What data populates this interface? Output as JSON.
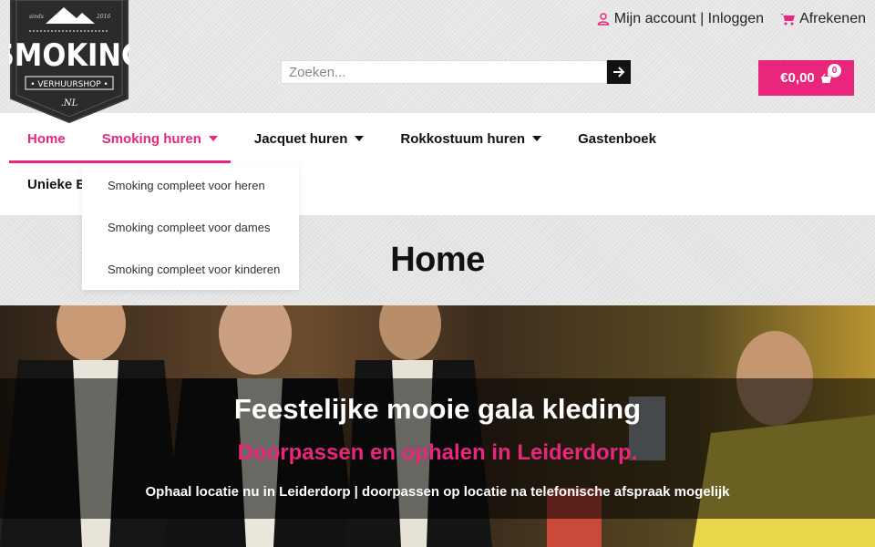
{
  "brand": {
    "since": "sinds",
    "year": "2016",
    "name": "SMOKING",
    "sub": "VERHUURSHOP",
    "tld": ".NL"
  },
  "topbar": {
    "account_label": "Mijn account | Inloggen",
    "checkout_label": "Afrekenen"
  },
  "search": {
    "placeholder": "Zoeken..."
  },
  "cart": {
    "total": "€0,00",
    "count": "0"
  },
  "nav": {
    "items": [
      {
        "label": "Home"
      },
      {
        "label": "Smoking huren"
      },
      {
        "label": "Jacquet huren"
      },
      {
        "label": "Rokkostuum huren"
      },
      {
        "label": "Gastenboek"
      }
    ],
    "row2_label": "Unieke B"
  },
  "dropdown": {
    "items": [
      {
        "label": "Smoking compleet voor heren"
      },
      {
        "label": "Smoking compleet voor dames"
      },
      {
        "label": "Smoking compleet voor kinderen"
      }
    ]
  },
  "page": {
    "title": "Home"
  },
  "hero": {
    "heading": "Feestelijke mooie gala kleding",
    "subheading": "Doorpassen en ophalen in Leiderdorp.",
    "note": "Ophaal locatie nu in Leiderdorp | doorpassen op locatie na telefonische afspraak mogelijk"
  },
  "colors": {
    "accent": "#e8267c",
    "dark": "#111111"
  }
}
